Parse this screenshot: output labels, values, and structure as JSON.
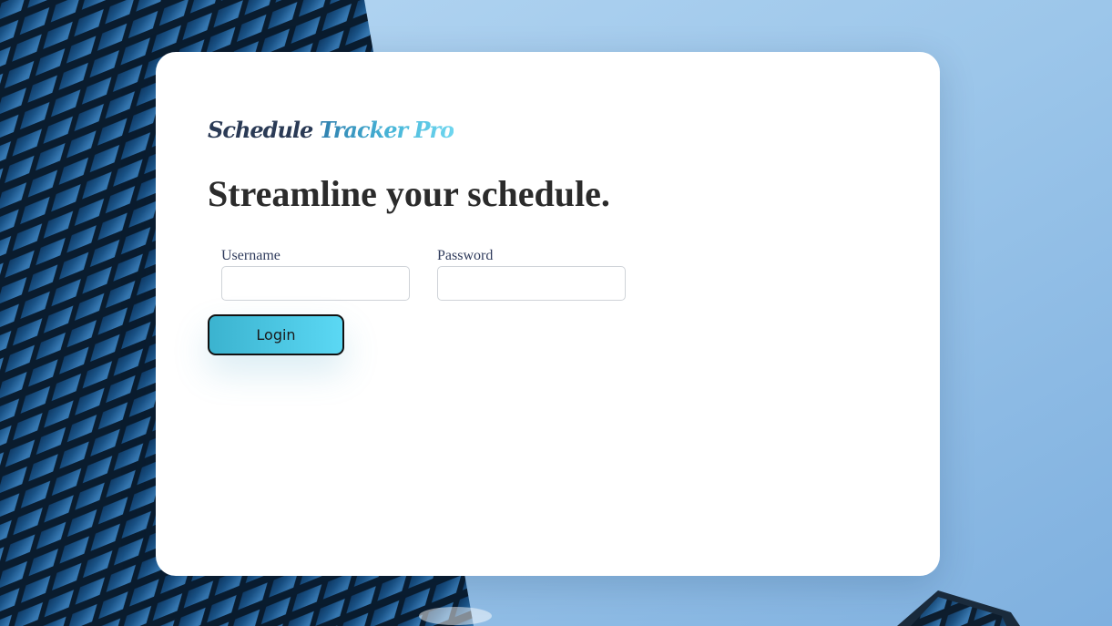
{
  "brand": {
    "part1": "Schedule",
    "part2": "Tracker Pro"
  },
  "headline": "Streamline your schedule.",
  "form": {
    "username_label": "Username",
    "username_value": "",
    "password_label": "Password",
    "password_value": "",
    "login_label": "Login"
  },
  "colors": {
    "sky": "#9cc6ea",
    "building_glass": "#1f5c93",
    "brand_dark": "#2a3a55",
    "brand_accent": "#49b7d9",
    "button_start": "#3bb3cf",
    "button_end": "#5bd8f4"
  }
}
